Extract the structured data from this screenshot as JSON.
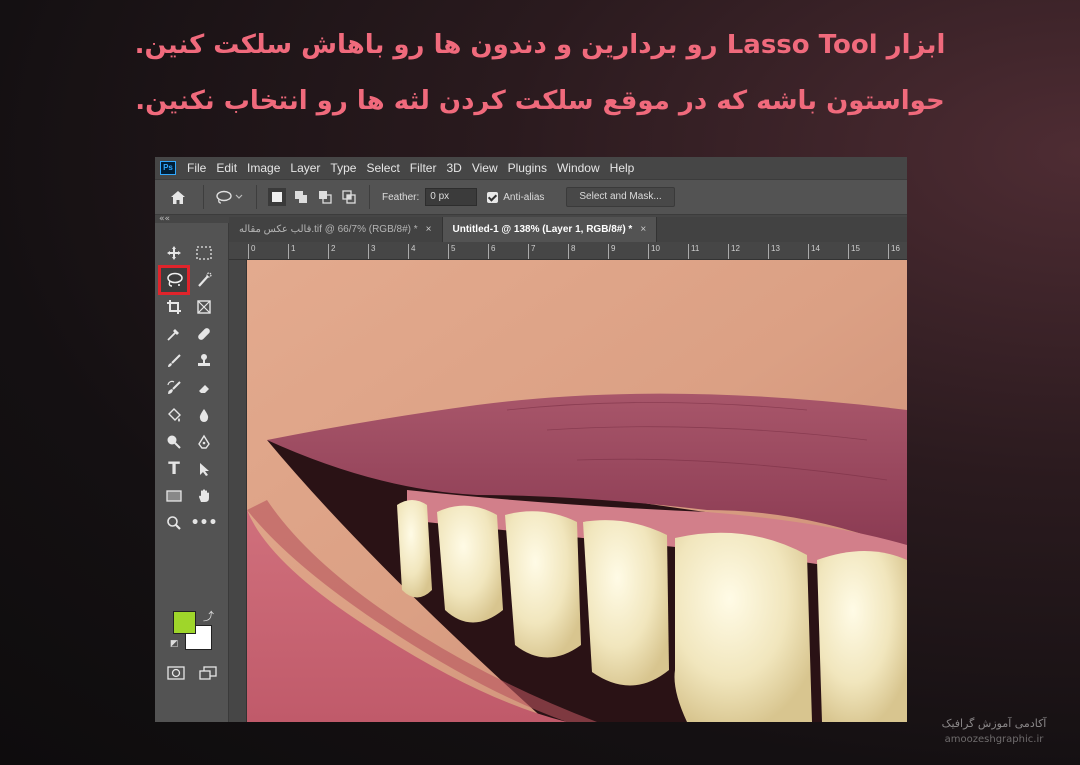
{
  "caption": {
    "line1": "ابزار Lasso Tool رو بردارین و دندون ها رو باهاش سلکت کنین.",
    "line2": "حواستون باشه که در موقع سلکت کردن لثه ها رو انتخاب نکنین."
  },
  "photoshop": {
    "logo": "Ps",
    "menu": [
      "File",
      "Edit",
      "Image",
      "Layer",
      "Type",
      "Select",
      "Filter",
      "3D",
      "View",
      "Plugins",
      "Window",
      "Help"
    ],
    "options": {
      "feather_label": "Feather:",
      "feather_value": "0 px",
      "antialias_label": "Anti-alias",
      "select_mask_label": "Select and Mask..."
    },
    "collapse": "««",
    "tabs": [
      {
        "label": "قالب عکس مقاله.tif @ 66/7% (RGB/8#) *",
        "active": false
      },
      {
        "label": "Untitled-1 @ 138% (Layer 1, RGB/8#) *",
        "active": true
      }
    ],
    "tab_close": "×",
    "ruler_ticks": [
      "0",
      "1",
      "2",
      "3",
      "4",
      "5",
      "6",
      "7",
      "8",
      "9",
      "10",
      "11",
      "12",
      "13",
      "14",
      "15",
      "16"
    ],
    "colors": {
      "foreground": "#9fd62a",
      "background": "#ffffff",
      "highlight": "#e0242b"
    },
    "tools": [
      "move-icon",
      "marquee-icon",
      "lasso-icon",
      "quick-select-icon",
      "crop-icon",
      "frame-icon",
      "eyedropper-icon",
      "healing-brush-icon",
      "brush-icon",
      "clone-stamp-icon",
      "history-brush-icon",
      "eraser-icon",
      "paint-bucket-icon",
      "blur-icon",
      "dodge-icon",
      "pen-icon",
      "type-icon",
      "path-select-icon",
      "rectangle-icon",
      "hand-icon",
      "zoom-icon",
      "more-tools-icon"
    ]
  },
  "watermark": {
    "fa": "آکادمی آموزش گرافیک",
    "en": "amoozeshgraphic.ir"
  }
}
